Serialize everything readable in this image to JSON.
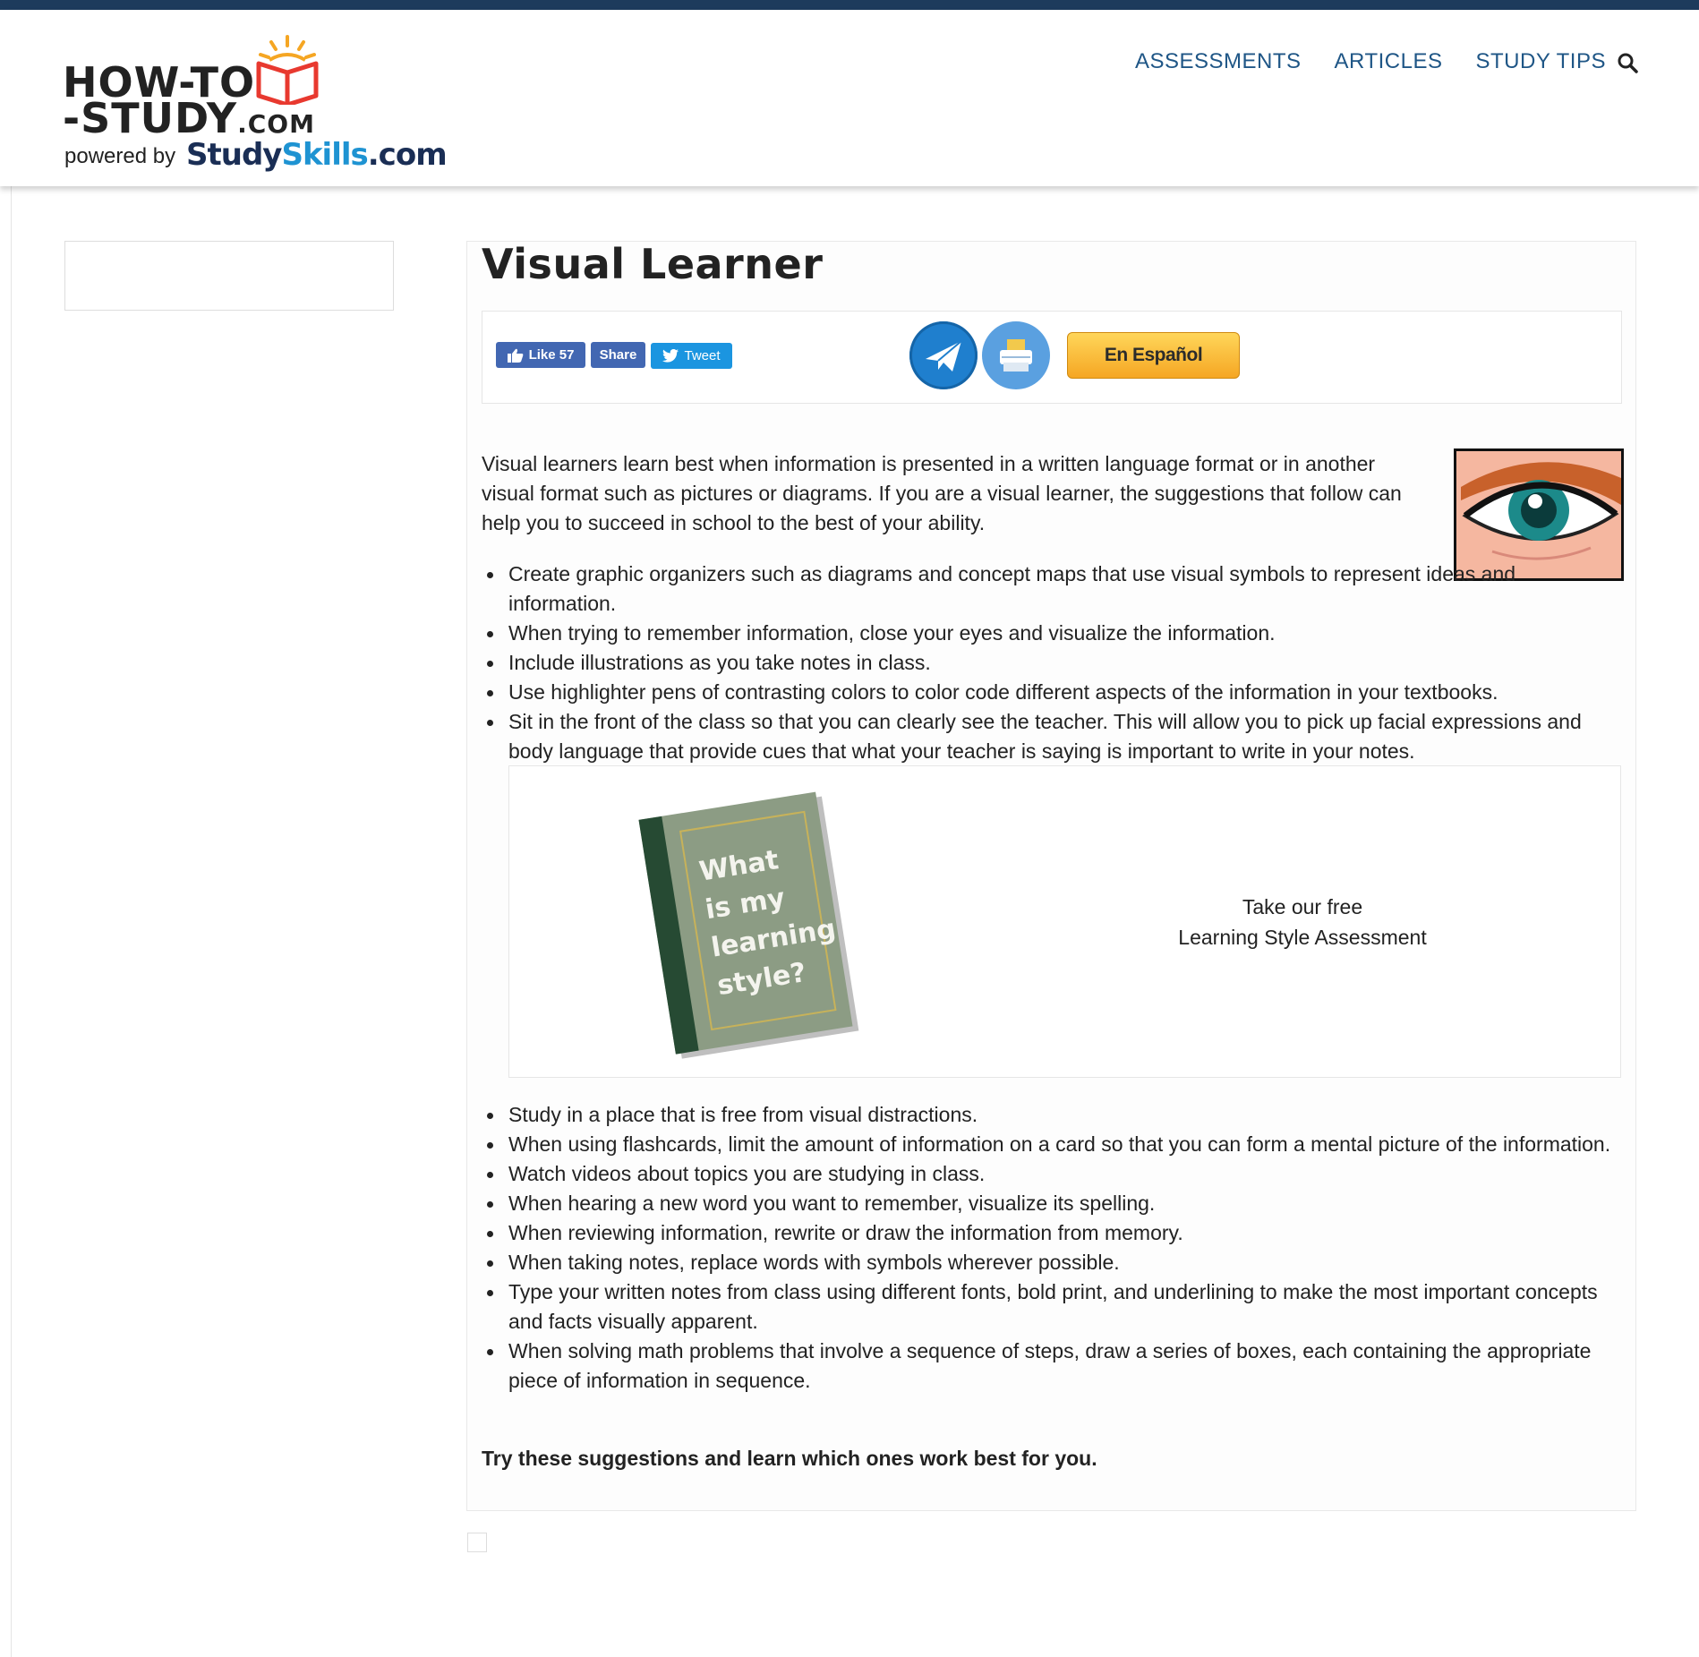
{
  "header": {
    "logo_line1": "HOW-TO",
    "logo_line2": "-STUDY",
    "logo_suffix": ".COM",
    "powered_by": "powered by",
    "studyskills_a": "Study",
    "studyskills_b": "Skills",
    "studyskills_c": ".com",
    "nav": [
      {
        "label": "ASSESSMENTS"
      },
      {
        "label": "ARTICLES"
      },
      {
        "label": "STUDY TIPS"
      }
    ],
    "search_icon": "search-icon"
  },
  "article": {
    "title": "Visual Learner",
    "social": {
      "like_label": "Like 57",
      "share_label": "Share",
      "tweet_label": "Tweet",
      "email_icon": "email-icon",
      "print_icon": "print-icon",
      "espanol_label": "En Español"
    },
    "intro": "Visual learners learn best when information is presented in a written language format or in another visual format such as pictures or diagrams. If you are a visual learner, the suggestions that follow can help you to succeed in school to the best of your ability.",
    "tips_part1": [
      "Create graphic organizers such as diagrams and concept maps that use visual symbols to represent ideas and information.",
      "When trying to remember information, close your eyes and visualize the information.",
      "Include illustrations as you take notes in class.",
      "Use highlighter pens of contrasting colors to color code different aspects of the information in your textbooks.",
      "Sit in the front of the class so that you can clearly see the teacher. This will allow you to pick up facial expressions and body language that provide cues that what your teacher is saying is important to write in your notes."
    ],
    "promo": {
      "book_text": [
        "What",
        "is my",
        "learning",
        "style?"
      ],
      "line1": "Take our free",
      "line2": "Learning Style Assessment"
    },
    "tips_part2": [
      "Study in a place that is free from visual distractions.",
      "When using flashcards, limit the amount of information on a card so that you can form a mental picture of the information.",
      "Watch videos about topics you are studying in class.",
      "When hearing a new word you want to remember, visualize its spelling.",
      "When reviewing information, rewrite or draw the information from memory.",
      "When taking notes, replace words with symbols wherever possible.",
      "Type your written notes from class using different fonts, bold print, and underlining to make the most important concepts and facts visually apparent.",
      "When solving math problems that involve a sequence of steps, draw a series of boxes, each containing the appropriate piece of information in sequence."
    ],
    "closing": "Try these suggestions and learn which ones work best for you."
  },
  "colors": {
    "topbar": "#1d3b5c",
    "nav": "#1f5686",
    "facebook": "#4267b2",
    "twitter": "#1b95e0",
    "espanol": "#f5a623"
  }
}
